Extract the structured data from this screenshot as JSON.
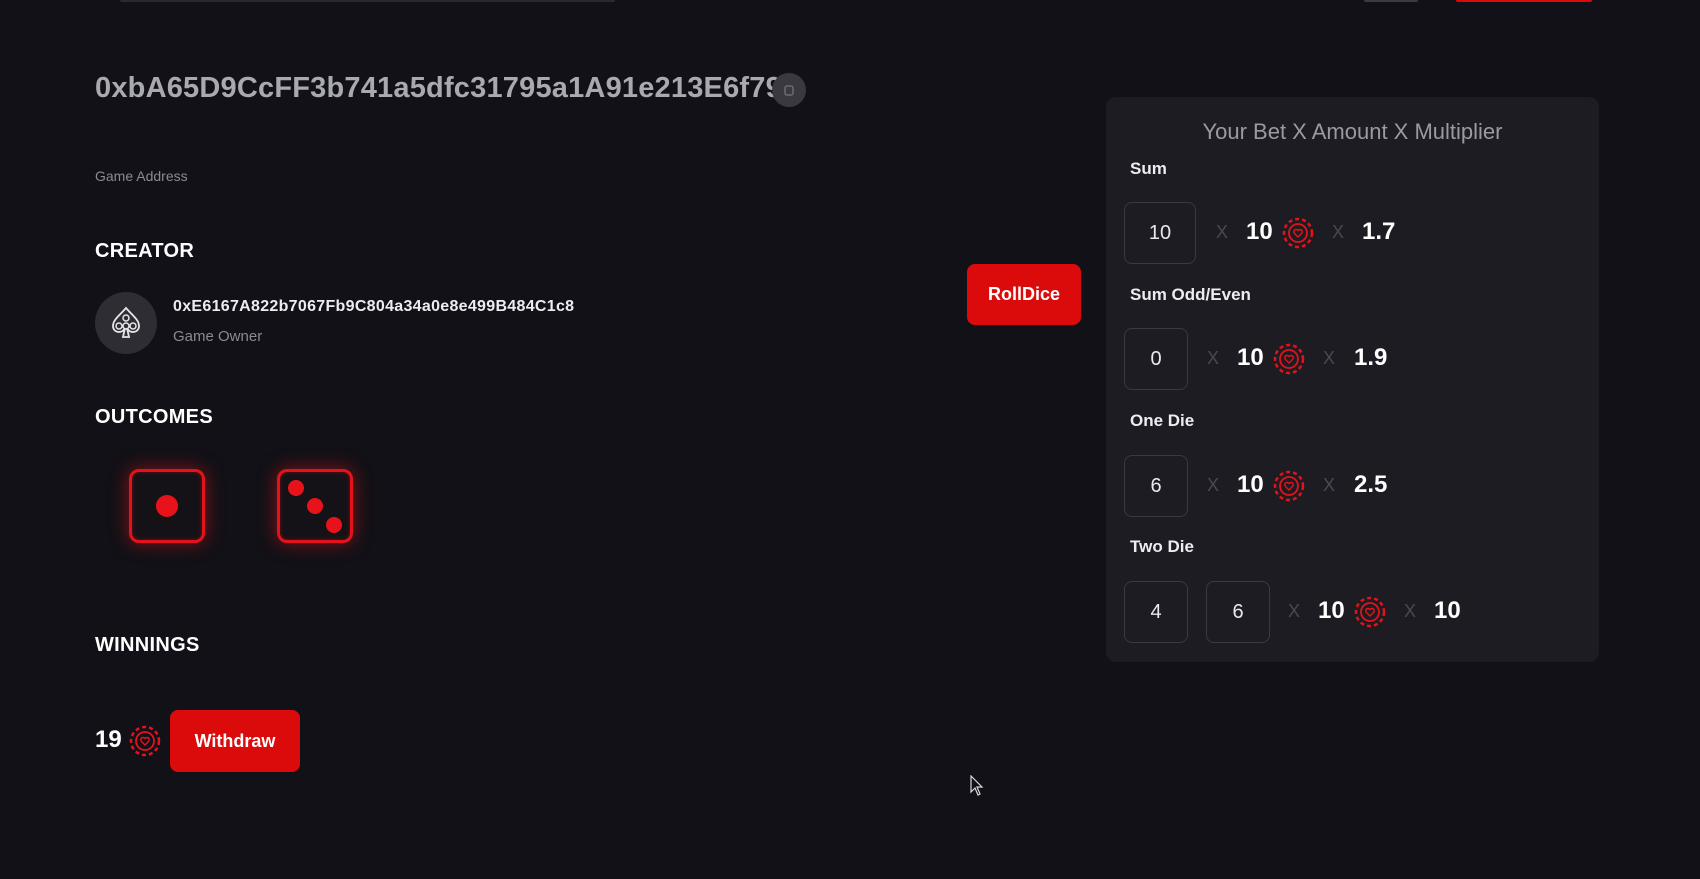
{
  "game": {
    "address": "0xbA65D9CcFF3b741a5dfc31795a1A91e213E6f795",
    "address_label": "Game Address"
  },
  "creator": {
    "title": "CREATOR",
    "address": "0xE6167A822b7067Fb9C804a34a0e8e499B484C1c8",
    "role": "Game Owner"
  },
  "actions": {
    "roll_dice": "RollDice",
    "withdraw": "Withdraw"
  },
  "outcomes": {
    "title": "OUTCOMES",
    "dice": [
      1,
      3
    ]
  },
  "winnings": {
    "title": "WINNINGS",
    "value": "19"
  },
  "bet_panel": {
    "title": "Your Bet X Amount X Multiplier",
    "separator": "X",
    "rows": [
      {
        "label": "Sum",
        "bets": [
          "10"
        ],
        "amount": "10",
        "multiplier": "1.7"
      },
      {
        "label": "Sum Odd/Even",
        "bets": [
          "0"
        ],
        "amount": "10",
        "multiplier": "1.9"
      },
      {
        "label": "One Die",
        "bets": [
          "6"
        ],
        "amount": "10",
        "multiplier": "2.5"
      },
      {
        "label": "Two Die",
        "bets": [
          "4",
          "6"
        ],
        "amount": "10",
        "multiplier": "10"
      }
    ]
  },
  "colors": {
    "accent": "#dc0b0b",
    "background": "#121117",
    "panel": "#1d1c22"
  }
}
